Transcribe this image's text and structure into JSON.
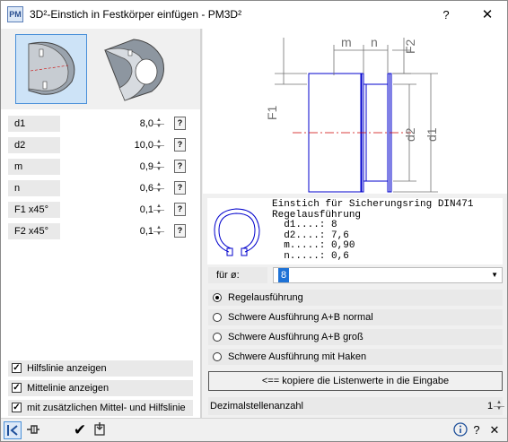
{
  "window": {
    "title": "3D²-Einstich in Festkörper einfügen   -   PM3D²",
    "help_label": "?",
    "close_label": "✕",
    "app_icon": "PM"
  },
  "params": [
    {
      "label": "d1",
      "value": "8,0"
    },
    {
      "label": "d2",
      "value": "10,0"
    },
    {
      "label": "m",
      "value": "0,9"
    },
    {
      "label": "n",
      "value": "0,6"
    },
    {
      "label": "F1 x45°",
      "value": "0,1"
    },
    {
      "label": "F2 x45°",
      "value": "0,1"
    }
  ],
  "checkboxes": [
    {
      "label": "Hilfslinie anzeigen",
      "checked": true
    },
    {
      "label": "Mittelinie anzeigen",
      "checked": true
    },
    {
      "label": "mit zusätzlichen Mittel- und Hilfslinie",
      "checked": true
    }
  ],
  "drawing": {
    "labels": {
      "m": "m",
      "n": "n",
      "F2": "F2",
      "F1": "F1",
      "d1": "d1",
      "d2": "d2"
    }
  },
  "info": {
    "text": "Einstich für Sicherungsring DIN471\nRegelausführung\n  d1....: 8\n  d2....: 7,6\n  m.....: 0,90\n  n.....: 0,6"
  },
  "fuer": {
    "label": "für ø:",
    "value": "8"
  },
  "radios": [
    {
      "label": "Regelausführung",
      "selected": true
    },
    {
      "label": "Schwere Ausführung A+B normal",
      "selected": false
    },
    {
      "label": "Schwere Ausführung A+B groß",
      "selected": false
    },
    {
      "label": "Schwere Ausführung mit Haken",
      "selected": false
    }
  ],
  "copy_button": "<== kopiere die Listenwerte in die Eingabe",
  "decimal": {
    "label": "Dezimalstellenanzahl",
    "value": "1"
  },
  "colors": {
    "drawing_blue": "#0000cc",
    "center_red": "#cc0000",
    "dimension_gray": "#707070",
    "selection_blue": "#1e72d6"
  }
}
